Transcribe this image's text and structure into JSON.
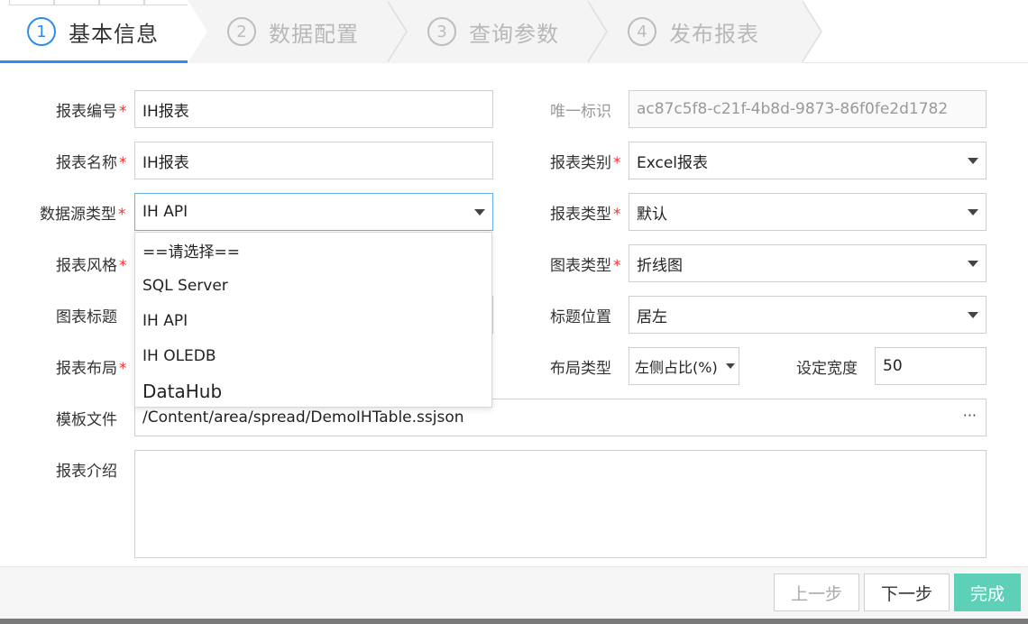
{
  "steps": [
    {
      "num": "1",
      "label": "基本信息"
    },
    {
      "num": "2",
      "label": "数据配置"
    },
    {
      "num": "3",
      "label": "查询参数"
    },
    {
      "num": "4",
      "label": "发布报表"
    }
  ],
  "form": {
    "report_no_label": "报表编号",
    "report_no_value": "IH报表",
    "unique_id_label": "唯一标识",
    "unique_id_value": "ac87c5f8-c21f-4b8d-9873-86f0fe2d1782",
    "report_name_label": "报表名称",
    "report_name_value": "IH报表",
    "report_category_label": "报表类别",
    "report_category_value": "Excel报表",
    "datasource_type_label": "数据源类型",
    "datasource_type_value": "IH API",
    "report_type_label": "报表类型",
    "report_type_value": "默认",
    "report_style_label": "报表风格",
    "chart_type_label": "图表类型",
    "chart_type_value": "折线图",
    "chart_title_label": "图表标题",
    "title_position_label": "标题位置",
    "title_position_value": "居左",
    "report_layout_label": "报表布局",
    "layout_type_label": "布局类型",
    "layout_type_value": "左侧占比(%)",
    "set_width_label": "设定宽度",
    "set_width_value": "50",
    "template_file_label": "模板文件",
    "template_file_value": "/Content/area/spread/DemoIHTable.ssjson",
    "template_browse": "···",
    "intro_label": "报表介绍",
    "required_mark": "*"
  },
  "dropdown_options": [
    "==请选择==",
    "SQL Server",
    "IH API",
    "IH OLEDB",
    "DataHub"
  ],
  "buttons": {
    "prev": "上一步",
    "next": "下一步",
    "finish": "完成"
  },
  "colors": {
    "accent": "#2d8cf0",
    "finish_button": "#5ed0b7",
    "required": "#e33333"
  }
}
